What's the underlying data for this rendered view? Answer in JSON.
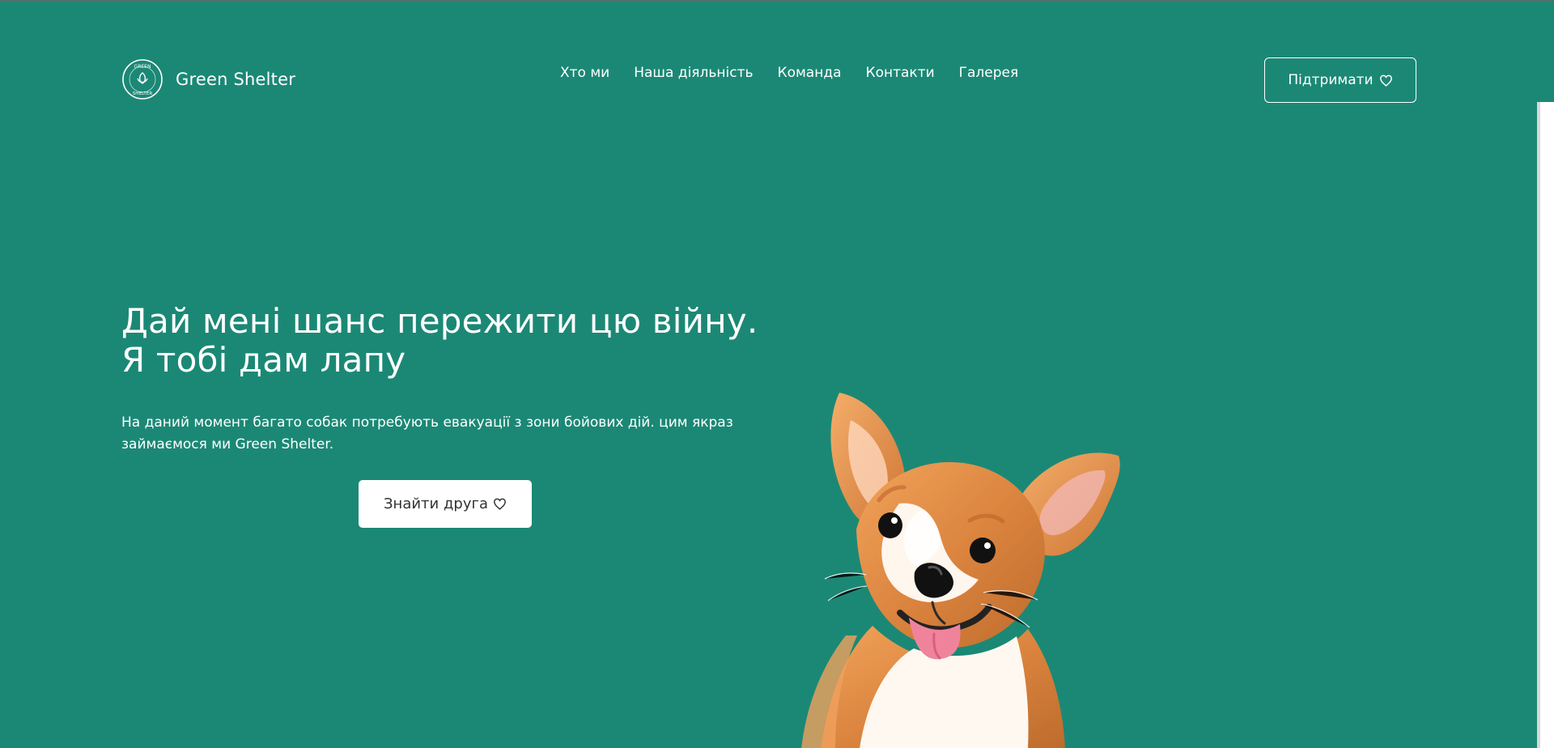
{
  "header": {
    "brand": "Green Shelter",
    "logo_ring_text_top": "GREEN",
    "logo_ring_text_bottom": "SHELTER",
    "nav": [
      "Хто ми",
      "Наша діяльність",
      "Команда",
      "Контакти",
      "Галерея"
    ],
    "support_label": "Підтримати"
  },
  "hero": {
    "title_line_1": "Дай мені шанс пережити цю війну.",
    "title_line_2": "Я тобі дам лапу",
    "description": "На даний момент багато собак потребують евакуації з зони бойових дій. цим якраз займаємося ми Green Shelter.",
    "cta_label": "Знайти друга"
  },
  "style": {
    "background": "#1b8875",
    "text": "#ffffff",
    "button_background": "#ffffff",
    "button_text": "#333333"
  },
  "icons": {
    "logo": "green-shelter-logo-icon",
    "heart": "heart-icon",
    "hero_image": "corgi-dog-photo"
  }
}
